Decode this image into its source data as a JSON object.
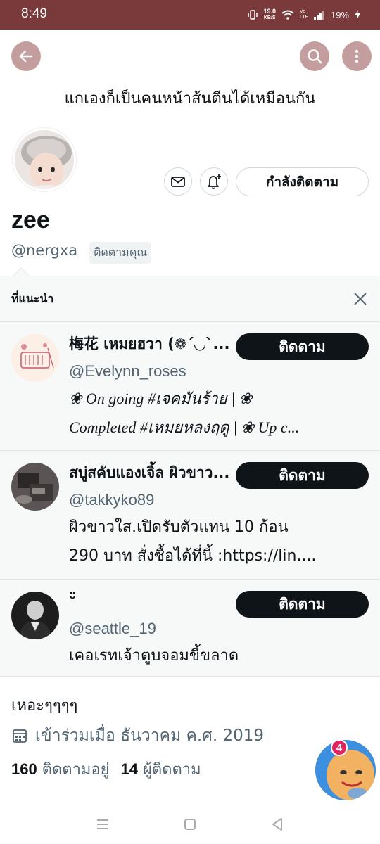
{
  "status_bar": {
    "time": "8:49",
    "speed_value": "19.0",
    "speed_unit": "KB/S",
    "network_label": "Vo LTE",
    "battery": "19%"
  },
  "header": {
    "title": "แกเองก็เป็นคนหน้าส้นตีนได้เหมือนกัน",
    "icons": [
      "back-arrow-icon",
      "search-icon",
      "more-vertical-icon"
    ]
  },
  "profile": {
    "display_name": "zee",
    "handle": "@nergxa",
    "follows_you": "ติดตามคุณ",
    "following_label": "กำลังติดตาม",
    "bio": "เหอะๆๆๆๆ",
    "joined": "เข้าร่วมเมื่อ ธันวาคม ค.ศ. 2019",
    "following_count": "160",
    "following_label_stat": "ติดตามอยู่",
    "followers_count": "14",
    "followers_label": "ผู้ติดตาม"
  },
  "suggestions": {
    "title": "ที่แนะนำ",
    "items": [
      {
        "name": "梅花 เหมยฮวา (❁´◡`...",
        "handle": "@Evelynn_roses",
        "bio_line1": "❀ On going #เจคมันร้าย | ❀",
        "bio_line2": "Completed #เหมยหลงฤดู | ❀ Up c...",
        "follow_label": "ติดตาม"
      },
      {
        "name": "สบู่สคับแองเจิ้ล ผิวขาว...",
        "handle": "@takkyko89",
        "bio_line1": "ผิวขาวใส.เปิดรับตัวแทน 10 ก้อน",
        "bio_line2": "290 บาท สั่งซื้อได้ที่นี้ :https://lin....",
        "follow_label": "ติดตาม"
      },
      {
        "name": "ᵕ̈",
        "handle": "@seattle_19",
        "bio_line1": "เคอเรทเจ้าตูบจอมขี้ขลาด",
        "follow_label": "ติดตาม"
      }
    ]
  },
  "fab": {
    "badge": "4"
  },
  "colors": {
    "status_bar": "#7a3a3b",
    "header_button": "#c49e9e",
    "follow_button": "#0f1419",
    "secondary_text": "#536471"
  }
}
